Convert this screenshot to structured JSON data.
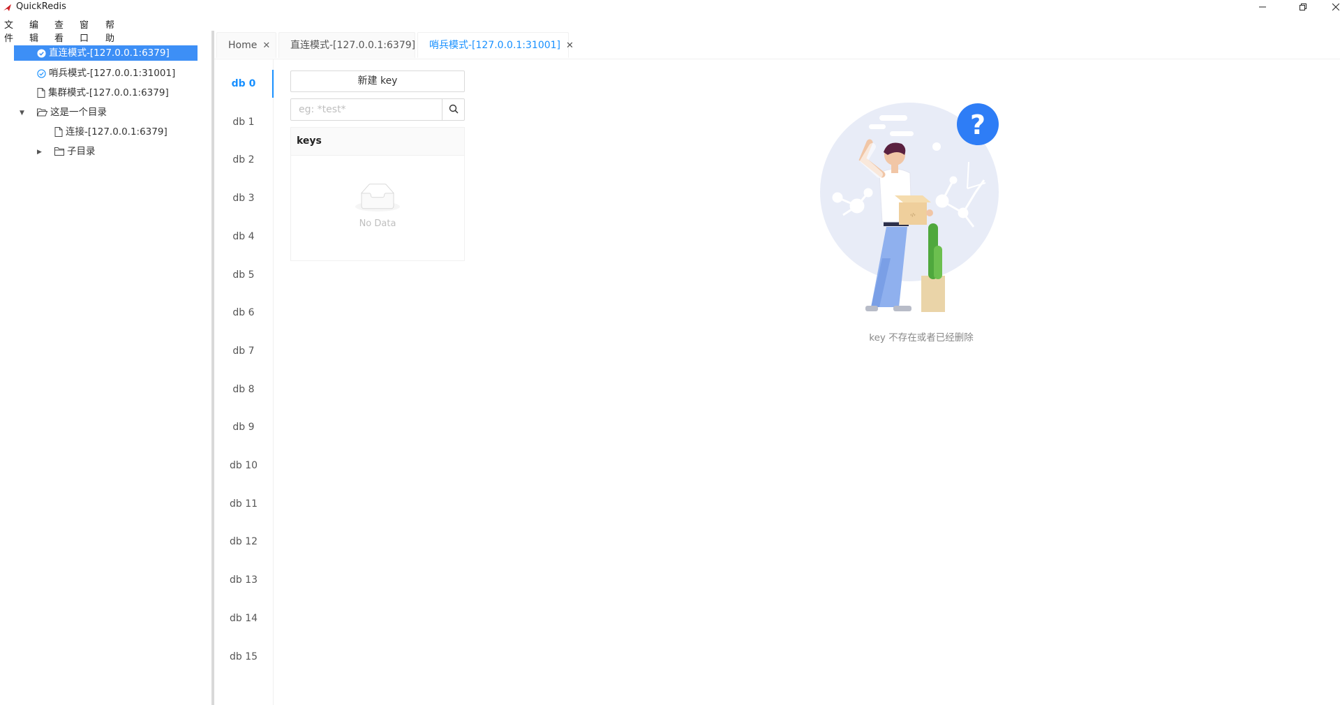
{
  "window": {
    "title": "QuickRedis",
    "controls": [
      "minimize-icon",
      "restore-icon",
      "close-icon"
    ]
  },
  "menu": [
    "文件",
    "编辑",
    "查看",
    "窗口",
    "帮助"
  ],
  "tree": [
    {
      "label": "直连模式-[127.0.0.1:6379]",
      "icon": "check-circle-filled-icon",
      "selected": true
    },
    {
      "label": "哨兵模式-[127.0.0.1:31001]",
      "icon": "check-circle-outline-icon",
      "selected": false
    },
    {
      "label": "集群模式-[127.0.0.1:6379]",
      "icon": "file-icon",
      "selected": false
    },
    {
      "label": "这是一个目录",
      "icon": "folder-open-icon",
      "expanded": true
    },
    {
      "label": "连接-[127.0.0.1:6379]",
      "icon": "file-icon",
      "selected": false
    },
    {
      "label": "子目录",
      "icon": "folder-icon",
      "expanded": false
    }
  ],
  "tabs": [
    {
      "label": "Home",
      "active": false
    },
    {
      "label": "直连模式-[127.0.0.1:6379]",
      "active": false
    },
    {
      "label": "哨兵模式-[127.0.0.1:31001]",
      "active": true
    }
  ],
  "databases": [
    "db 0",
    "db 1",
    "db 2",
    "db 3",
    "db 4",
    "db 5",
    "db 6",
    "db 7",
    "db 8",
    "db 9",
    "db 10",
    "db 11",
    "db 12",
    "db 13",
    "db 14",
    "db 15"
  ],
  "active_db": "db 0",
  "key_panel": {
    "new_key_label": "新建 key",
    "search_placeholder": "eg: *test*",
    "search_value": "",
    "table_header": "keys",
    "empty_text": "No Data"
  },
  "detail": {
    "empty_message": "key 不存在或者已经删除"
  },
  "colors": {
    "accent": "#1890ff",
    "selected_bg": "#3d8ff6"
  }
}
